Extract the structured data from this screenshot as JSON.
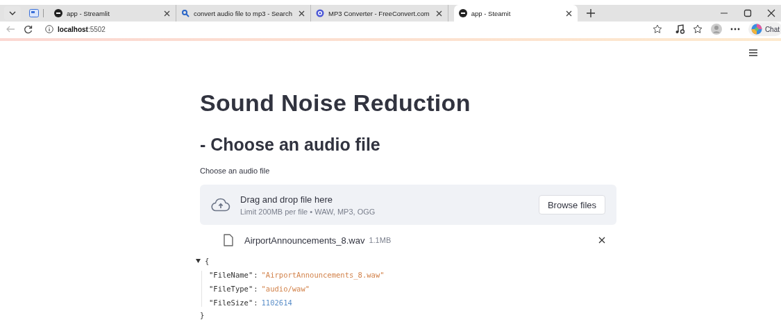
{
  "browser": {
    "tabs": [
      {
        "title": "app - Streamlit",
        "kind": "app",
        "selected": false
      },
      {
        "title": "convert audio file to mp3 - Search",
        "kind": "search",
        "selected": false
      },
      {
        "title": "MP3 Converter - FreeConvert.com",
        "kind": "target",
        "selected": false
      },
      {
        "title": "app - Steamit",
        "kind": "app",
        "selected": true
      }
    ],
    "address": {
      "host": "localhost",
      "port": ":5502"
    },
    "chat_label": "Chat"
  },
  "page": {
    "title": "Sound Noise Reduction",
    "subheader": "- Choose an audio file",
    "uploader": {
      "label": "Choose an audio file",
      "drop_text": "Drag and drop file here",
      "limit_text": "Limit 200MB per file • WAW, MP3, OGG",
      "button": "Browse files"
    },
    "uploaded_file": {
      "name": "AirportAnnouncements_8.wav",
      "size": "1.1MB"
    },
    "json_view": {
      "expanded": true,
      "open": "{",
      "close": "}",
      "entries": [
        {
          "key": "\"FileName\"",
          "separator": ":",
          "value": "\"AirportAnnouncements_8.waw\"",
          "kind": "string"
        },
        {
          "key": "\"FileType\"",
          "separator": ":",
          "value": "\"audio/waw\"",
          "kind": "string"
        },
        {
          "key": "\"FileSize\"",
          "separator": ":",
          "value": "1102614",
          "kind": "number"
        }
      ]
    }
  }
}
